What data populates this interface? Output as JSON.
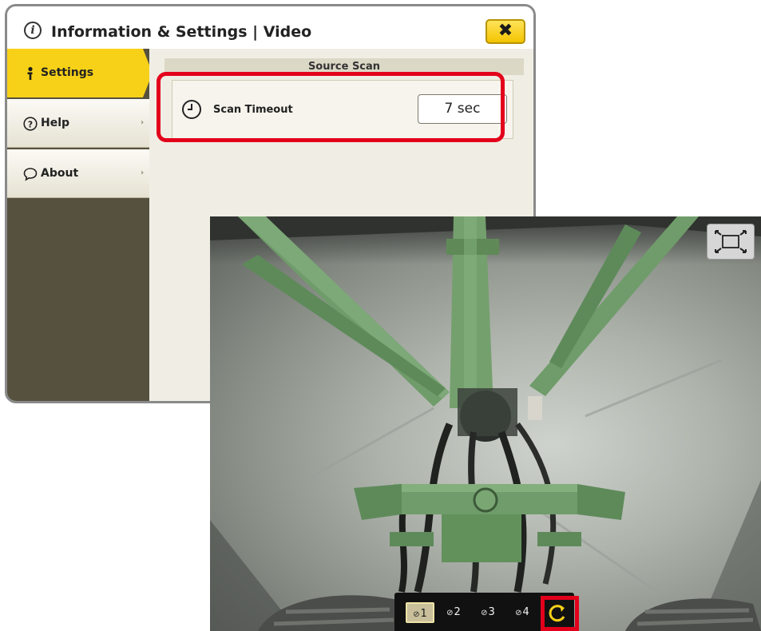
{
  "window": {
    "title": "Information & Settings | Video",
    "close_label": "✖"
  },
  "nav": {
    "items": [
      {
        "label": "Settings",
        "icon": "person-info-icon",
        "active": true
      },
      {
        "label": "Help",
        "icon": "question-circle-icon",
        "arrow": "›"
      },
      {
        "label": "About",
        "icon": "speech-bubble-icon",
        "arrow": "›"
      }
    ]
  },
  "content": {
    "section_title": "Source Scan",
    "setting": {
      "label": "Scan Timeout",
      "value": "7 sec",
      "icon": "clock-icon"
    }
  },
  "camera": {
    "buttons": [
      "1",
      "2",
      "3",
      "4"
    ],
    "active_index": 0,
    "scan_icon": "source-scan-icon",
    "expand_icon": "expand-fullscreen-icon"
  },
  "colors": {
    "accent_yellow": "#f7d117",
    "highlight_red": "#e3001b",
    "nav_dark": "#56513f",
    "implement_green": "#6f9c6a"
  }
}
